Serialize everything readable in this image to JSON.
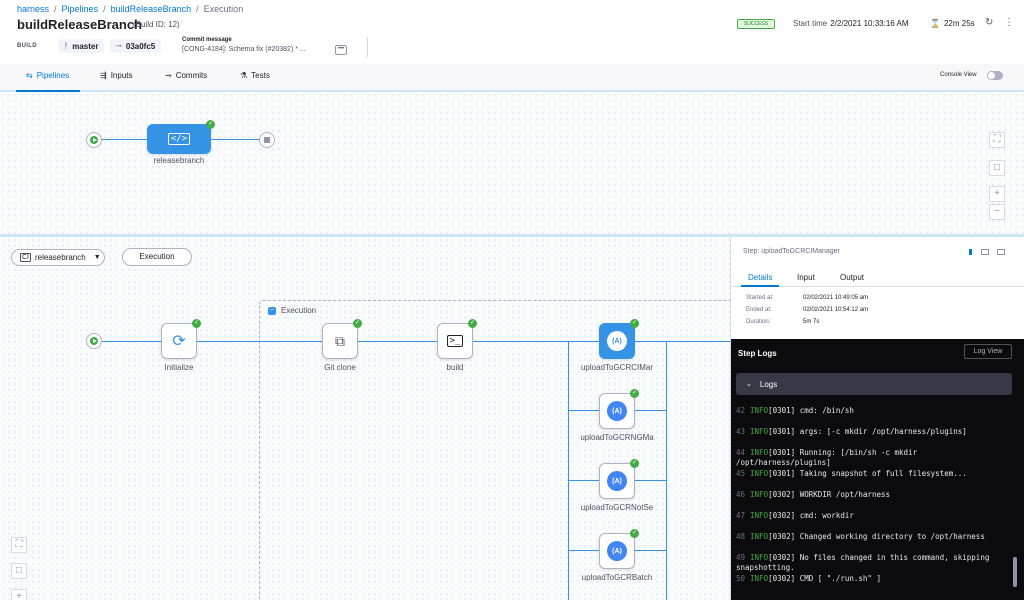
{
  "breadcrumb": [
    "harness",
    "Pipelines",
    "buildReleaseBranch",
    "Execution"
  ],
  "separator": "/",
  "title": "buildReleaseBranch",
  "build_id": "(Build ID: 12)",
  "build_label": "BUILD",
  "branch": "master",
  "commit_sha": "03a0fc5",
  "commit_message_label": "Commit message",
  "commit_message": "[CONG-4184]: Schema fix (#20382) * ...",
  "status": "SUCCESS",
  "start_label": "Start time",
  "start_time": "2/2/2021 10:33:16 AM",
  "duration": "22m 25s",
  "tabs": [
    {
      "label": "Pipelines",
      "icon": "pipeline-icon"
    },
    {
      "label": "Inputs",
      "icon": "inputs-icon"
    },
    {
      "label": "Commits",
      "icon": "commit-icon"
    },
    {
      "label": "Tests",
      "icon": "flask-icon"
    }
  ],
  "console_view": "Console View",
  "top_stage": "releasebranch",
  "stage_selector": "releasebranch",
  "execution_button": "Execution",
  "execution_group": "Execution",
  "steps": {
    "initialize": "Initialize",
    "git_clone": "Git clone",
    "build": "build",
    "upload1": "uploadToGCRCIMar",
    "upload2": "uploadToGCRNGMa",
    "upload3": "uploadToGCRNotSe",
    "upload4": "uploadToGCRBatch"
  },
  "panel": {
    "step": "Step: uploadToGCRCIManager",
    "tabs": [
      "Details",
      "Input",
      "Output"
    ],
    "started_label": "Started at:",
    "started": "02/02/2021 10:49:05 am",
    "ended_label": "Ended at:",
    "ended": "02/02/2021 10:54:12 am",
    "duration_label": "Duration:",
    "duration": "5m 7s",
    "step_logs": "Step Logs",
    "log_view": "Log View",
    "logs_section": "Logs"
  },
  "log_lines": [
    {
      "n": "42",
      "tag": "INFO",
      "text": "[0301] cmd: /bin/sh"
    },
    {
      "n": "43",
      "tag": "INFO",
      "text": "[0301] args: [-c mkdir /opt/harness/plugins]"
    },
    {
      "n": "44",
      "tag": "INFO",
      "text": "[0301] Running: [/bin/sh -c mkdir /opt/harness/plugins]"
    },
    {
      "n": "45",
      "tag": "INFO",
      "text": "[0301] Taking snapshot of full filesystem..."
    },
    {
      "n": "46",
      "tag": "INFO",
      "text": "[0302] WORKDIR /opt/harness"
    },
    {
      "n": "47",
      "tag": "INFO",
      "text": "[0302] cmd: workdir"
    },
    {
      "n": "48",
      "tag": "INFO",
      "text": "[0302] Changed working directory to /opt/harness"
    },
    {
      "n": "49",
      "tag": "INFO",
      "text": "[0302] No files changed in this command, skipping snapshotting."
    },
    {
      "n": "50",
      "tag": "INFO",
      "text": "[0302] CMD [ \"./run.sh\" ]"
    }
  ]
}
